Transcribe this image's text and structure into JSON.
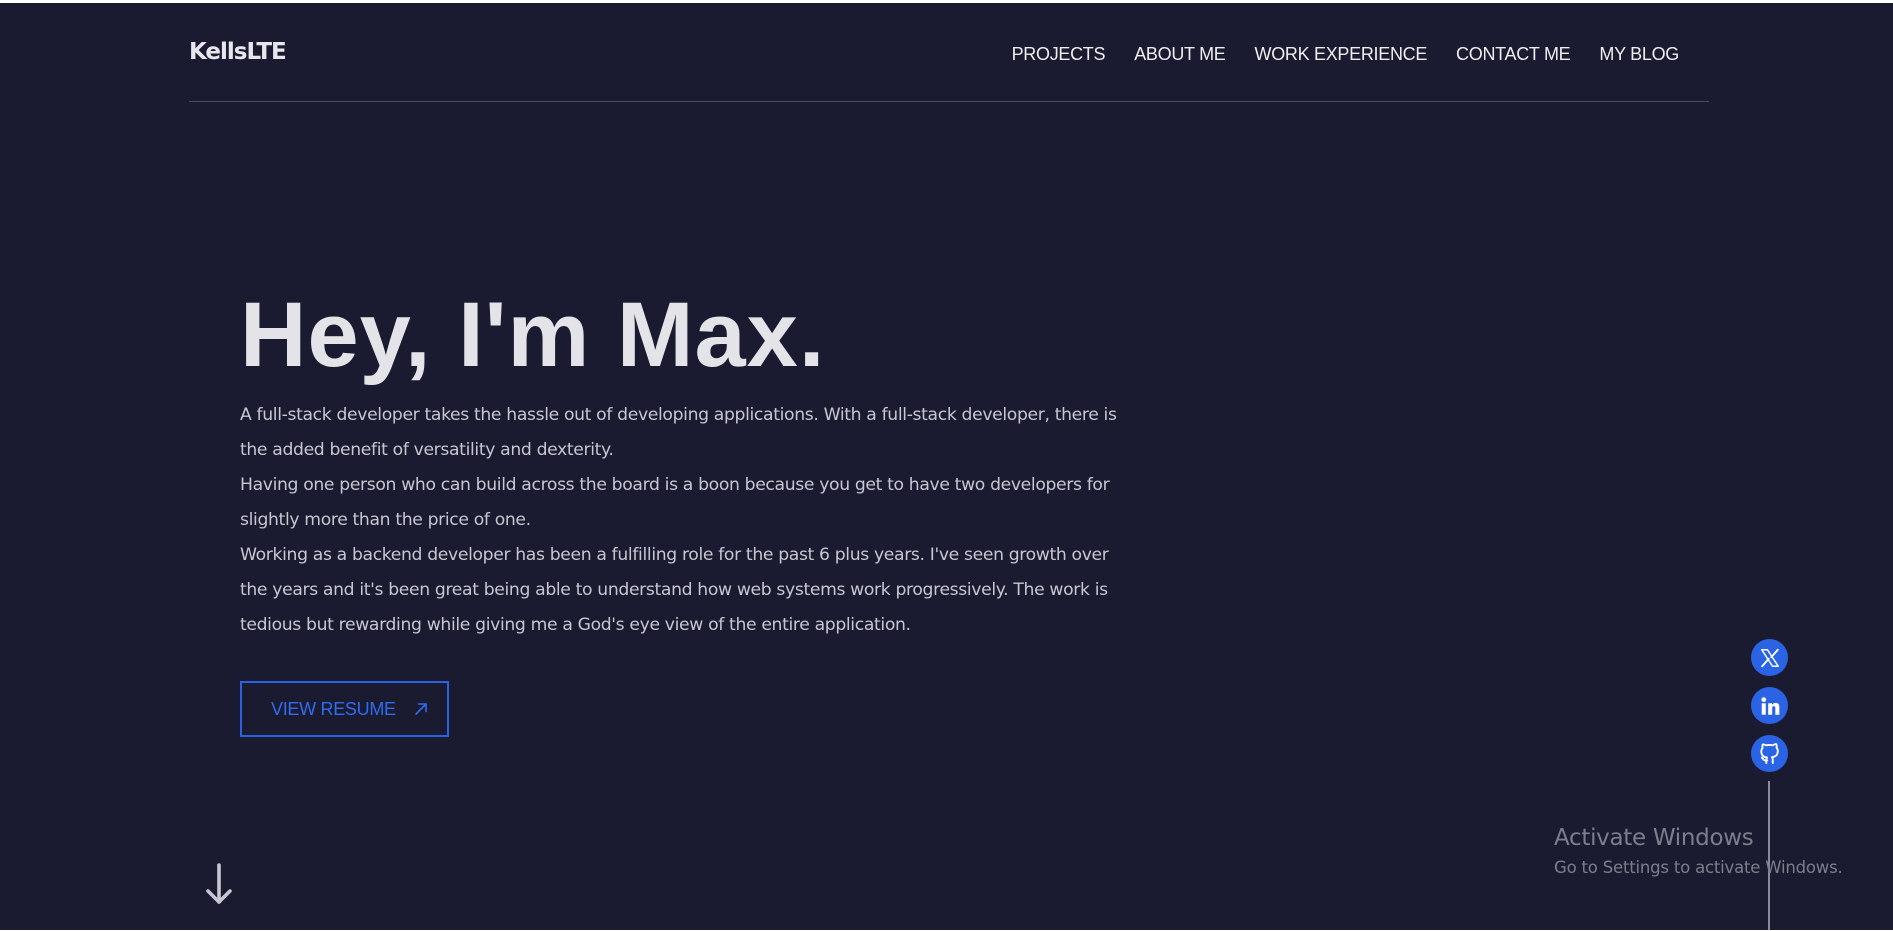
{
  "header": {
    "logo": "KellsLTE",
    "nav": [
      "PROJECTS",
      "ABOUT ME",
      "WORK EXPERIENCE",
      "CONTACT ME",
      "MY BLOG"
    ]
  },
  "hero": {
    "headline": "Hey, I'm Max.",
    "paragraphs": [
      "A full-stack developer takes the hassle out of developing applications. With a full-stack developer, there is the added benefit of versatility and dexterity.",
      "Having one person who can build across the board is a boon because you get to have two developers for slightly more than the price of one.",
      "Working as a backend developer has been a fulfilling role for the past 6 plus years. I've seen growth over the years and it's been great being able to understand how web systems work progressively. The work is tedious but rewarding while giving me a God's eye view of the entire application."
    ],
    "resume_button": "VIEW RESUME",
    "resume_icon": "arrow-up-right-icon",
    "scroll_icon": "arrow-down-icon"
  },
  "socials": [
    {
      "name": "x-twitter-icon"
    },
    {
      "name": "linkedin-icon"
    },
    {
      "name": "github-icon"
    }
  ],
  "watermark": {
    "title": "Activate Windows",
    "subtitle": "Go to Settings to activate Windows."
  },
  "colors": {
    "background": "#1a1a30",
    "accent": "#2a62e6",
    "text": "#c6c7d1",
    "heading": "#e4e4e8"
  }
}
